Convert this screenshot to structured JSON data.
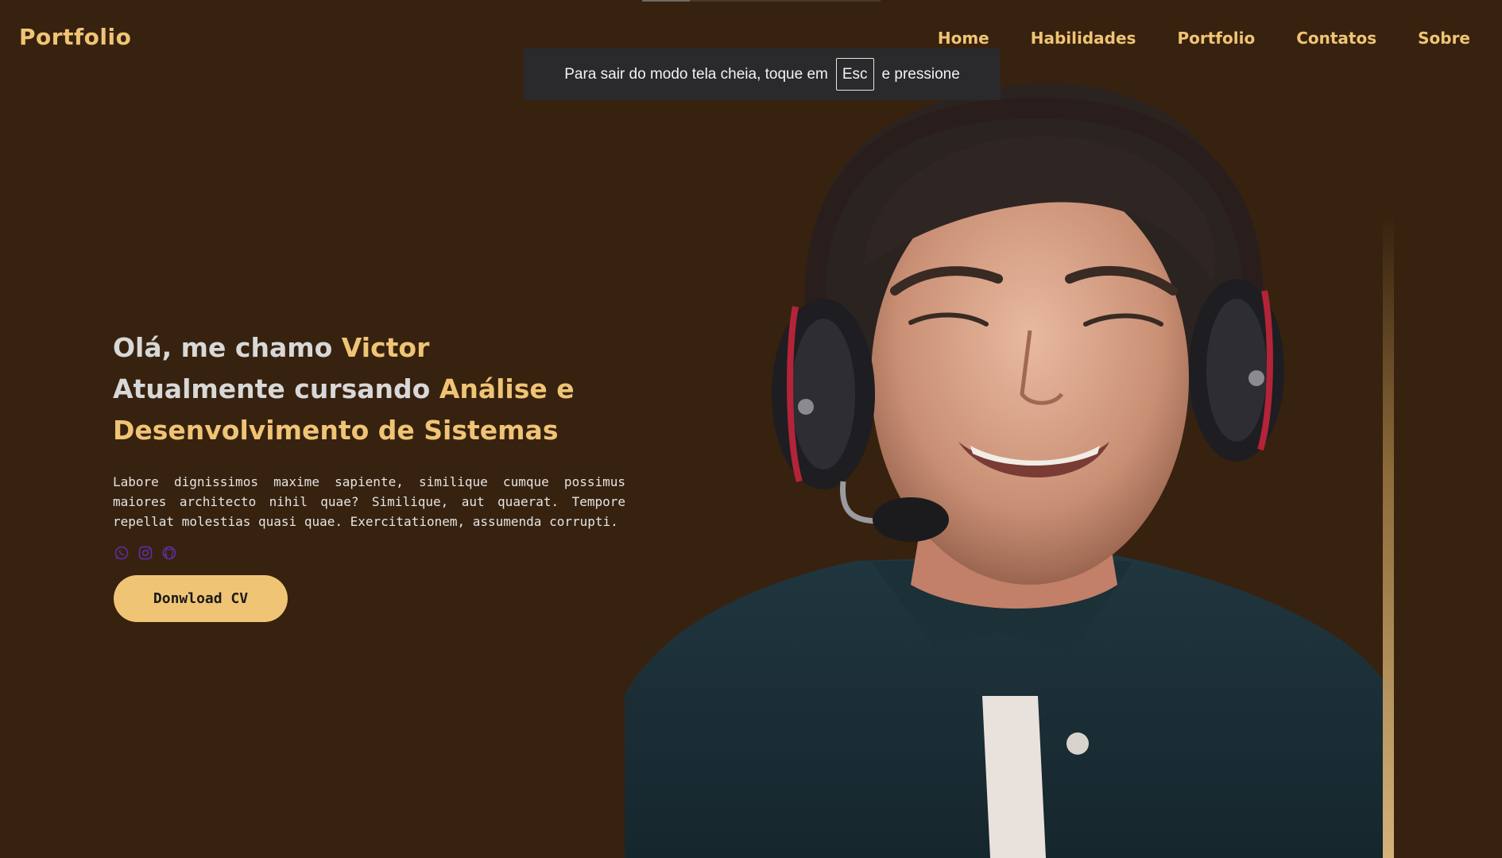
{
  "header": {
    "logo": "Portfolio",
    "nav": [
      "Home",
      "Habilidades",
      "Portfolio",
      "Contatos",
      "Sobre"
    ]
  },
  "fullscreen_notice": {
    "before": "Para sair do modo tela cheia, toque em",
    "key": "Esc",
    "after": "e pressione"
  },
  "hero": {
    "line1_prefix": "Olá, me chamo ",
    "line1_name": "Victor",
    "line2_prefix": "Atualmente cursando ",
    "line2_accent": "Análise e",
    "line3_accent": "Desenvolvimento de Sistemas",
    "description": "Labore dignissimos maxime sapiente, similique cumque possimus maiores architecto nihil quae? Similique, aut quaerat. Tempore repellat molestias quasi quae. Exercitationem, assumenda corrupti.",
    "cv_button": "Donwload CV"
  },
  "socials": [
    "whatsapp-icon",
    "instagram-icon",
    "github-icon"
  ],
  "colors": {
    "background": "#37220f",
    "accent": "#f0c475",
    "social_icon": "#5b2fa0"
  }
}
